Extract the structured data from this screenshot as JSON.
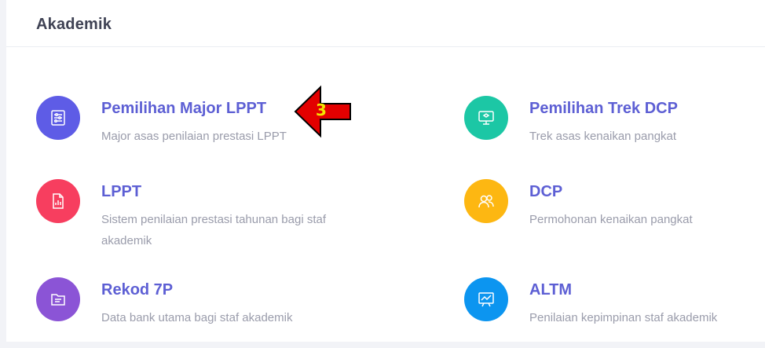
{
  "section": {
    "title": "Akademik"
  },
  "items": [
    {
      "title": "Pemilihan Major LPPT",
      "desc": "Major asas penilaian prestasi LPPT",
      "icon": "sliders-icon",
      "color": "#5e5ce6"
    },
    {
      "title": "Pemilihan Trek DCP",
      "desc": "Trek asas kenaikan pangkat",
      "icon": "monitor-icon",
      "color": "#1cc7a5"
    },
    {
      "title": "LPPT",
      "desc": "Sistem penilaian prestasi tahunan bagi staf akademik",
      "icon": "document-chart-icon",
      "color": "#f73e5f"
    },
    {
      "title": "DCP",
      "desc": "Permohonan kenaikan pangkat",
      "icon": "users-icon",
      "color": "#fdb712"
    },
    {
      "title": "Rekod 7P",
      "desc": "Data bank utama bagi staf akademik",
      "icon": "folder-icon",
      "color": "#8b54d6"
    },
    {
      "title": "ALTM",
      "desc": "Penilaian kepimpinan staf akademik",
      "icon": "chart-board-icon",
      "color": "#0c95f0"
    }
  ],
  "annotation": {
    "label": "3",
    "color": "#e30000"
  }
}
